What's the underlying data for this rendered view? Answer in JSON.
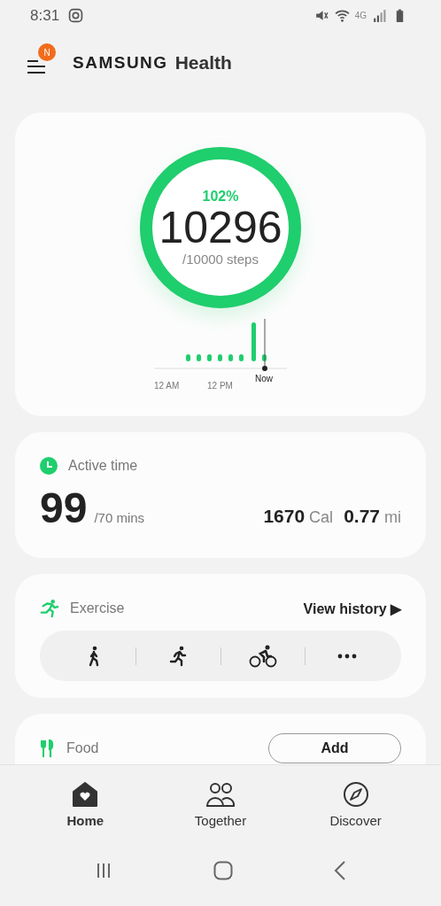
{
  "status_bar": {
    "time": "8:31",
    "network": "4G"
  },
  "header": {
    "badge": "N",
    "brand": "SAMSUNG",
    "app": "Health"
  },
  "steps": {
    "percent": "102%",
    "count": "10296",
    "goal": "/10000 steps",
    "level": 1,
    "axis_labels": [
      "12 AM",
      "12 PM",
      "Now"
    ]
  },
  "active_time": {
    "title": "Active time",
    "value": "99",
    "goal": "/70 mins",
    "calories": "1670",
    "calories_unit": "Cal",
    "distance": "0.77",
    "distance_unit": "mi"
  },
  "exercise": {
    "title": "Exercise",
    "link": "View history",
    "link_arrow": "▶",
    "shortcuts": [
      {
        "kind": "walk"
      },
      {
        "kind": "run"
      },
      {
        "kind": "cycle"
      },
      {
        "kind": "more"
      }
    ]
  },
  "food": {
    "title": "Food",
    "button": "Add"
  },
  "bottom_nav": [
    {
      "label": "Home",
      "kind": "home",
      "selected": true
    },
    {
      "label": "Together",
      "kind": "together",
      "selected": false
    },
    {
      "label": "Discover",
      "kind": "discover",
      "selected": false
    }
  ]
}
